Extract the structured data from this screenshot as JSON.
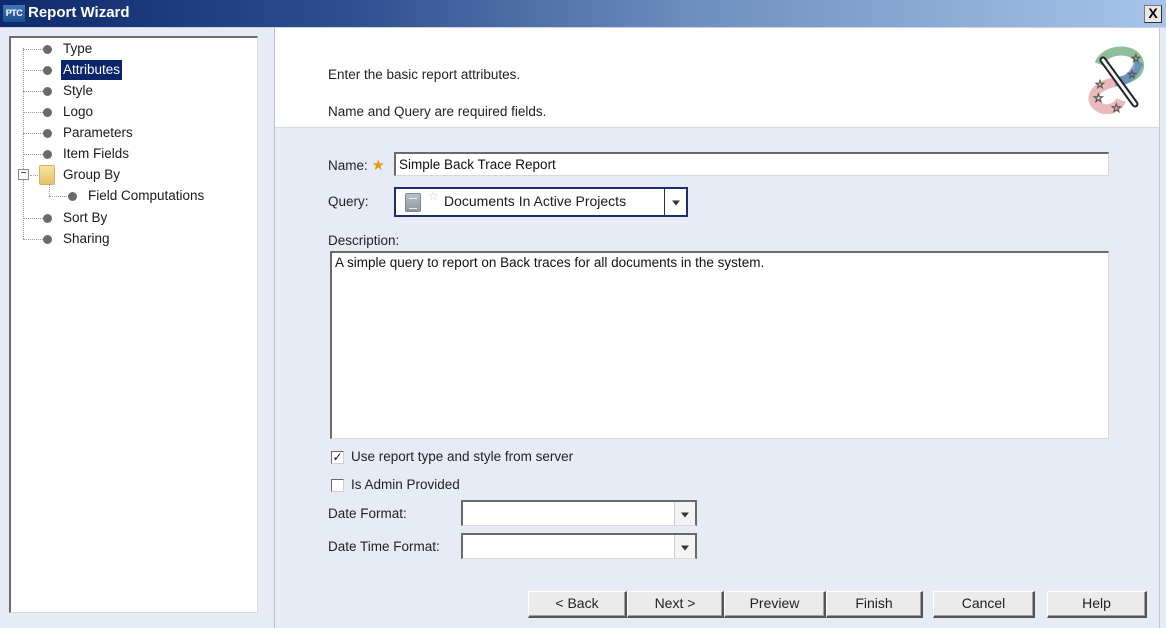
{
  "window": {
    "app_logo": "PTC",
    "title": "Report Wizard",
    "close_label": "X"
  },
  "tree": {
    "items": [
      {
        "label": "Type",
        "selected": false
      },
      {
        "label": "Attributes",
        "selected": true
      },
      {
        "label": "Style",
        "selected": false
      },
      {
        "label": "Logo",
        "selected": false
      },
      {
        "label": "Parameters",
        "selected": false
      },
      {
        "label": "Item Fields",
        "selected": false
      },
      {
        "label": "Group By",
        "selected": false,
        "expanded": true,
        "icon": "folder-icon",
        "expander": "−"
      },
      {
        "label": "Field Computations",
        "selected": false,
        "child_of": "Group By"
      },
      {
        "label": "Sort By",
        "selected": false
      },
      {
        "label": "Sharing",
        "selected": false
      }
    ]
  },
  "header": {
    "line1": "Enter the basic report attributes.",
    "line2": "Name and Query are required fields.",
    "icon": "magic-wand-icon"
  },
  "form": {
    "name_label": "Name:",
    "required_marker": "★",
    "name_value": "Simple Back Trace Report",
    "query_label": "Query:",
    "query_value": "Documents In Active Projects",
    "query_star": "☆",
    "description_label": "Description:",
    "description_value": "A simple query to report on Back traces for all documents in the system.",
    "use_server_label": "Use report type and style from server",
    "use_server_checked": true,
    "admin_provided_label": "Is Admin Provided",
    "admin_provided_checked": false,
    "checkmark": "✓",
    "date_format_label": "Date Format:",
    "date_format_value": "",
    "date_time_format_label": "Date Time Format:",
    "date_time_format_value": ""
  },
  "buttons": {
    "back": "< Back",
    "next": "Next >",
    "preview": "Preview",
    "finish": "Finish",
    "cancel": "Cancel",
    "help": "Help"
  }
}
